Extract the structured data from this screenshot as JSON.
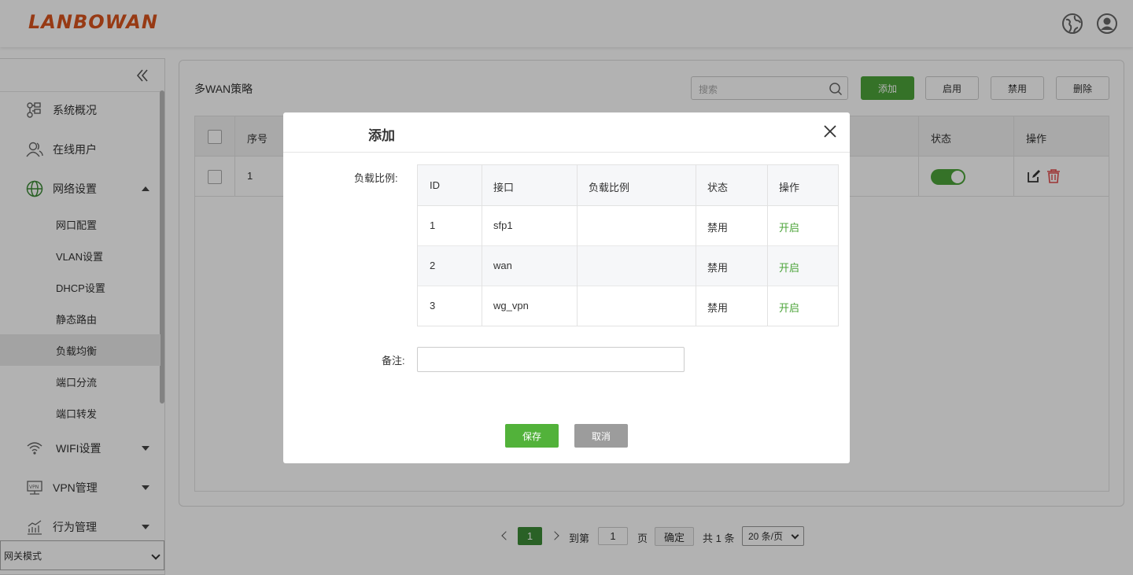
{
  "header": {
    "logo": "LANBOWAN",
    "globe_icon": "globe-icon",
    "user_icon": "user-icon"
  },
  "sidebar": {
    "items": [
      {
        "label": "系统概况",
        "icon": "overview-icon"
      },
      {
        "label": "在线用户",
        "icon": "users-icon"
      },
      {
        "label": "网络设置",
        "icon": "network-globe-icon",
        "expanded": true
      },
      {
        "label": "WIFI设置",
        "icon": "wifi-icon"
      },
      {
        "label": "VPN管理",
        "icon": "vpn-icon"
      },
      {
        "label": "行为管理",
        "icon": "behavior-chart-icon"
      }
    ],
    "subitems": [
      "网口配置",
      "VLAN设置",
      "DHCP设置",
      "静态路由",
      "负载均衡",
      "端口分流",
      "端口转发"
    ],
    "active_subitem": "负载均衡",
    "mode": "网关模式"
  },
  "main": {
    "title": "多WAN策略",
    "search_placeholder": "搜索",
    "buttons": {
      "add": "添加",
      "enable": "启用",
      "disable": "禁用",
      "delete": "删除"
    },
    "columns": {
      "index": "序号",
      "status": "状态",
      "action": "操作"
    },
    "rows": [
      {
        "index": "1",
        "status_on": true
      }
    ]
  },
  "pagination": {
    "current": "1",
    "goto": "到第",
    "page_value": "1",
    "page_unit": "页",
    "confirm": "确定",
    "total": "共 1 条",
    "per_page": "20 条/页"
  },
  "dialog": {
    "title": "添加",
    "ratio_label": "负载比例:",
    "remark_label": "备注:",
    "columns": [
      "ID",
      "接口",
      "负载比例",
      "状态",
      "操作"
    ],
    "rows": [
      {
        "id": "1",
        "iface": "sfp1",
        "ratio": "",
        "status": "禁用",
        "action": "开启"
      },
      {
        "id": "2",
        "iface": "wan",
        "ratio": "",
        "status": "禁用",
        "action": "开启"
      },
      {
        "id": "3",
        "iface": "wg_vpn",
        "ratio": "",
        "status": "禁用",
        "action": "开启"
      }
    ],
    "remark_value": "",
    "save": "保存",
    "cancel": "取消"
  },
  "colors": {
    "primary_green": "#4ca43a",
    "logo_orange": "#d9541e",
    "cancel_gray": "#9c9c9c"
  }
}
